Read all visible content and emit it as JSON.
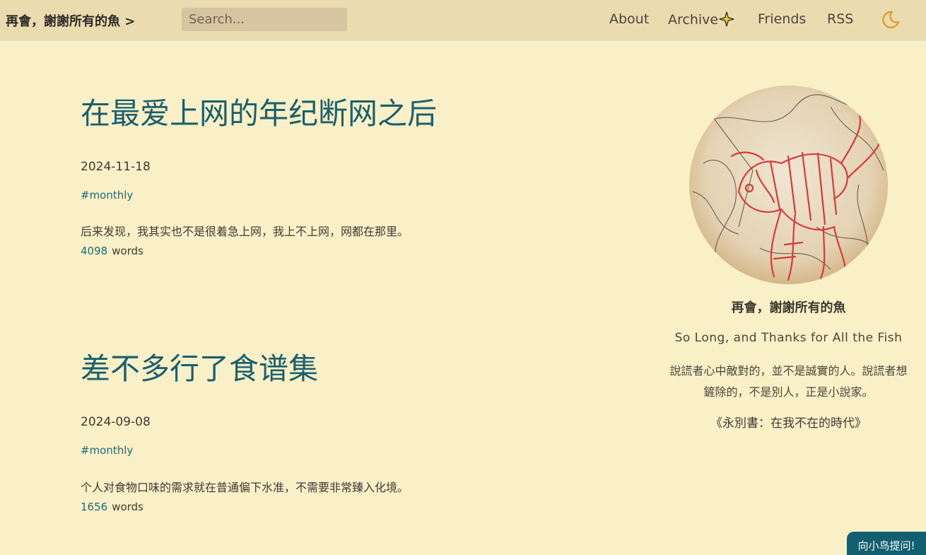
{
  "header": {
    "brand": "再會，謝謝所有的魚 >",
    "search_placeholder": "Search...",
    "nav": {
      "about": "About",
      "archive": "Archive",
      "friends": "Friends",
      "rss": "RSS"
    },
    "archive_icon": "sparkle-icon",
    "theme_icon": "moon-icon"
  },
  "posts": [
    {
      "title": "在最爱上网的年纪断网之后",
      "date": "2024-11-18",
      "tag": "#monthly",
      "excerpt": "后来发现，我其实也不是很着急上网，我上不上网，网都在那里。",
      "word_count": "4098",
      "words_label": "words"
    },
    {
      "title": "差不多行了食谱集",
      "date": "2024-09-08",
      "tag": "#monthly",
      "excerpt": "个人对食物口味的需求就在普通偏下水准，不需要非常臻入化境。",
      "word_count": "1656",
      "words_label": "words"
    }
  ],
  "sidebar": {
    "title": "再會，謝謝所有的魚",
    "subtitle": "So Long, and Thanks for All the Fish",
    "quote": "說謊者心中敵對的，並不是誠實的人。說謊者想鏟除的，不是別人，正是小說家。",
    "book": "《永別書：在我不在的時代》"
  },
  "ask_button": "向小鸟提问!",
  "colors": {
    "background": "#faf0c7",
    "header": "#ebdcb0",
    "accent": "#1a5f6e",
    "button": "#135f72",
    "moon": "#d9a030"
  }
}
